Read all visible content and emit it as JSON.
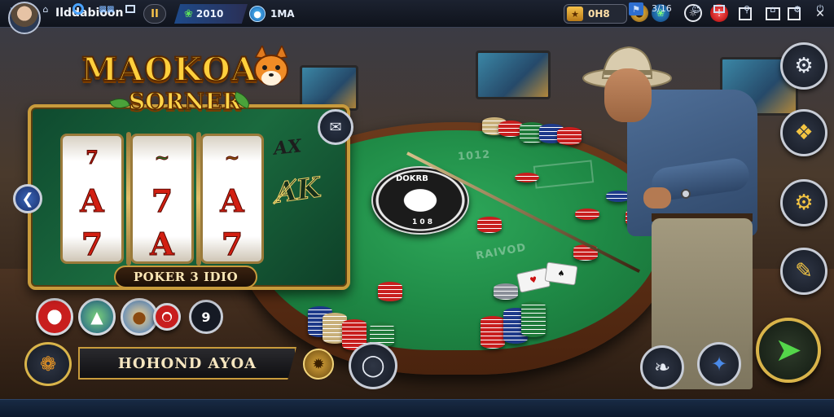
{
  "topbar": {
    "title": "Ilddabioon",
    "pause_label": "II",
    "score_value": "2010",
    "coins_value": "1MA",
    "gold_value": "0H8",
    "gold_icon": "treasure-icon",
    "menu_icons": [
      "coin-icon",
      "leaf-icon",
      "cloud-icon",
      "alert-icon"
    ],
    "window_controls": [
      "minimize",
      "restore",
      "maximize",
      "wrench",
      "close"
    ]
  },
  "logo": {
    "title": "MAOKOA",
    "subtitle": "SORNER"
  },
  "slot": {
    "reels": [
      [
        "7",
        "A",
        "7"
      ],
      [
        "7",
        "A",
        "A"
      ],
      [
        "A",
        "A",
        "7"
      ]
    ],
    "reel_top_marks": [
      "7",
      "~",
      "~"
    ],
    "side_text_small": "AX",
    "side_text_large": "A̸K",
    "button_label": "POKER 3 IDIO",
    "corner_icon": "envelope-icon",
    "left_icon": "back-arrow-icon"
  },
  "table": {
    "felt_texts": [
      "1012",
      "RAIVOD",
      "DOKRB",
      "1 0 8"
    ],
    "dial_top": "DOKRB",
    "dial_bottom": "1 0 8",
    "chip_colors": [
      "#c81e1e",
      "#1e3a8a",
      "#1f7a3a",
      "#d6d6d6",
      "#8a1ec8"
    ]
  },
  "hud": {
    "tokens": [
      "roulette-icon",
      "hat-wizard-icon",
      "animal-icon",
      "chip-icon"
    ],
    "counter_value": "9",
    "name_banner": "HOHOND AYOA",
    "emblem_icon": "sun-emblem-icon",
    "chat_icon": "chat-icon",
    "snack_icon": "snack-icon"
  },
  "actions": {
    "side_buttons": [
      "robot-icon",
      "ticket-icon",
      "gear-badge-icon",
      "pencil-icon"
    ],
    "bottom_buttons": [
      "hook-icon",
      "puzzle-icon"
    ],
    "go_icon": "arrow-go-icon"
  },
  "taskbar": {
    "left_items": [
      "back-icon",
      "home-icon",
      "browser-icon",
      "apps-icon",
      "window-icon"
    ],
    "clock": "3/16",
    "right_items": [
      "flag-icon",
      "smile-icon",
      "chat-icon",
      "location-icon",
      "home-icon",
      "settings-icon"
    ]
  },
  "colors": {
    "gold": "#c89b3c",
    "felt_green": "#1f8a46",
    "accent_green": "#54d64a",
    "topbar_bg": "#0f131c"
  }
}
